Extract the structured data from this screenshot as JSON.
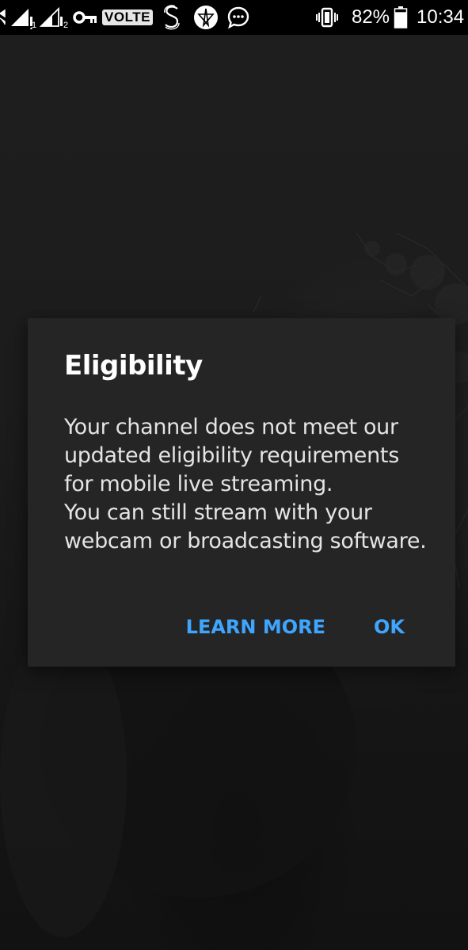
{
  "status_bar": {
    "volte_label": "VOLTE",
    "sim1_label": "1",
    "sim2_label": "2",
    "battery_text": "82%",
    "time": "10:34",
    "icons": [
      "data-arrow-icon",
      "signal-sim1-icon",
      "signal-sim2-icon",
      "vpn-key-icon",
      "volte-badge",
      "s-app-icon",
      "star-app-icon",
      "chat-bubble-icon",
      "vibrate-icon",
      "battery-icon"
    ],
    "battery_level": 0.82
  },
  "dialog": {
    "title": "Eligibility",
    "message_line_1": "Your channel does not meet our updated eligibility requirements for mobile live streaming.",
    "message_line_2": "You can still stream with your webcam or broadcasting software.",
    "learn_more_label": "LEARN MORE",
    "ok_label": "OK",
    "accent_color": "#3ea6ff",
    "background_color": "#252525"
  }
}
